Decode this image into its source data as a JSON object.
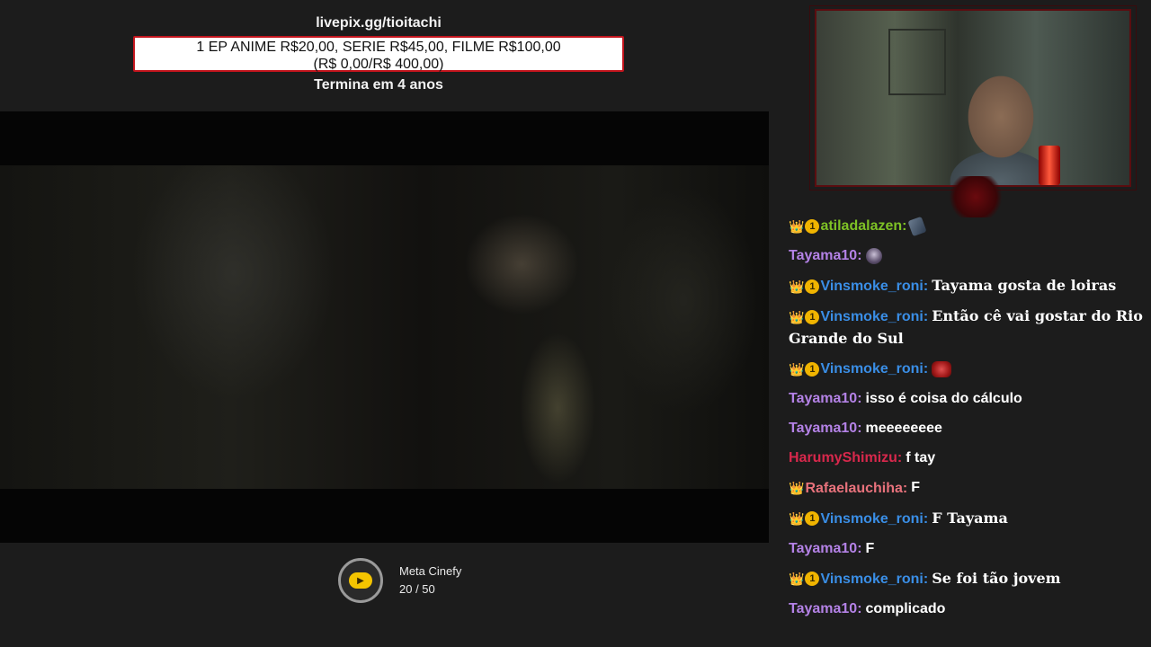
{
  "donation": {
    "url": "livepix.gg/tioitachi",
    "prices": "1 EP ANIME R$20,00, SERIE R$45,00, FILME R$100,00",
    "progress": "(R$ 0,00/R$ 400,00)",
    "ends": "Termina em 4 anos"
  },
  "goal": {
    "title": "Meta Cinefy",
    "progress_text": "20 / 50",
    "current": 20,
    "target": 50
  },
  "colors": {
    "accent_red": "#c2141c",
    "crown_gold": "#f2b705"
  },
  "chat": {
    "messages": [
      {
        "user": "atiladalazen:",
        "color": "#7ec225",
        "badges": [
          "crown",
          "1"
        ],
        "text": "",
        "emote": "phone"
      },
      {
        "user": "Tayama10:",
        "color": "#b482e6",
        "badges": [],
        "text": "",
        "emote": "ninja"
      },
      {
        "user": "Vinsmoke_roni:",
        "color": "#3a8ee6",
        "badges": [
          "crown",
          "1"
        ],
        "text": "Tayama gosta de loiras",
        "emote": ""
      },
      {
        "user": "Vinsmoke_roni:",
        "color": "#3a8ee6",
        "badges": [
          "crown",
          "1"
        ],
        "text": "Então cê vai gostar do Rio Grande do Sul",
        "emote": ""
      },
      {
        "user": "Vinsmoke_roni:",
        "color": "#3a8ee6",
        "badges": [
          "crown",
          "1"
        ],
        "text": "",
        "emote": "demon"
      },
      {
        "user": "Tayama10:",
        "color": "#b482e6",
        "badges": [],
        "text": "isso é coisa do cálculo",
        "emote": ""
      },
      {
        "user": "Tayama10:",
        "color": "#b482e6",
        "badges": [],
        "text": "meeeeeeee",
        "emote": ""
      },
      {
        "user": "HarumyShimizu:",
        "color": "#d8284c",
        "badges": [],
        "text": "f tay",
        "emote": ""
      },
      {
        "user": "Rafaelauchiha:",
        "color": "#e8727c",
        "badges": [
          "crown"
        ],
        "text": "F",
        "emote": ""
      },
      {
        "user": "Vinsmoke_roni:",
        "color": "#3a8ee6",
        "badges": [
          "crown",
          "1"
        ],
        "text": "F Tayama",
        "emote": ""
      },
      {
        "user": "Tayama10:",
        "color": "#b482e6",
        "badges": [],
        "text": "F",
        "emote": ""
      },
      {
        "user": "Vinsmoke_roni:",
        "color": "#3a8ee6",
        "badges": [
          "crown",
          "1"
        ],
        "text": "Se foi tão jovem",
        "emote": ""
      },
      {
        "user": "Tayama10:",
        "color": "#b482e6",
        "badges": [],
        "text": "complicado",
        "emote": ""
      }
    ]
  }
}
